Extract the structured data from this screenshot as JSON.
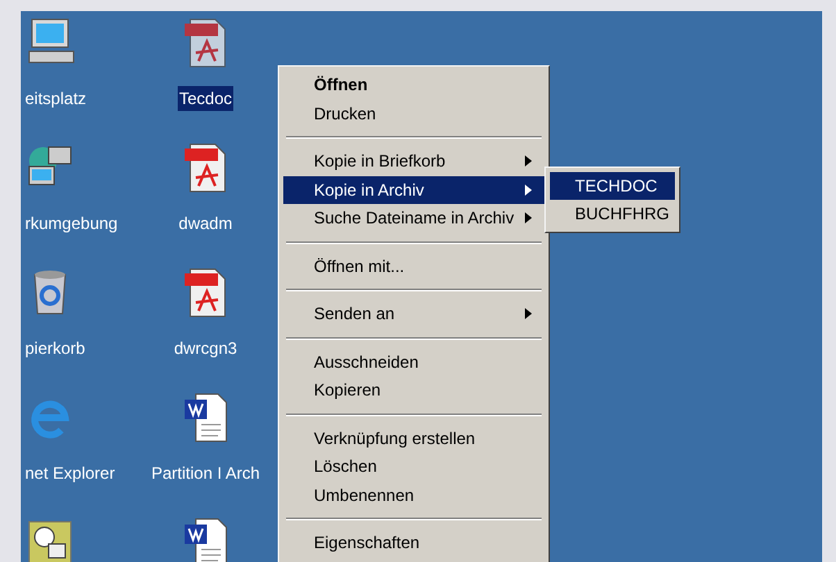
{
  "desktop_icons": [
    {
      "kind": "computer",
      "label": "eitsplatz",
      "selected": false
    },
    {
      "kind": "network",
      "label": "rkumgebung",
      "selected": false
    },
    {
      "kind": "recycle",
      "label": "pierkorb",
      "selected": false
    },
    {
      "kind": "browser",
      "label": "net Explorer",
      "selected": false
    },
    {
      "kind": "task",
      "selected": false
    },
    {
      "kind": "pdf",
      "label": "Tecdoc",
      "selected": true
    },
    {
      "kind": "pdf",
      "label": "dwadm",
      "selected": false
    },
    {
      "kind": "pdf",
      "label": "dwrcgn3",
      "selected": false
    },
    {
      "kind": "word",
      "label": "Partition I Arch",
      "selected": false
    },
    {
      "kind": "word",
      "selected": false
    }
  ],
  "context_menu": {
    "sections": [
      [
        {
          "label": "Öffnen",
          "default": true,
          "submenu": false,
          "selected": false
        },
        {
          "label": "Drucken",
          "default": false,
          "submenu": false,
          "selected": false
        }
      ],
      [
        {
          "label": "Kopie in Briefkorb",
          "default": false,
          "submenu": true,
          "selected": false
        },
        {
          "label": "Kopie in Archiv",
          "default": false,
          "submenu": true,
          "selected": true
        },
        {
          "label": "Suche Dateiname in Archiv",
          "default": false,
          "submenu": true,
          "selected": false
        }
      ],
      [
        {
          "label": "Öffnen mit...",
          "default": false,
          "submenu": false,
          "selected": false
        }
      ],
      [
        {
          "label": "Senden an",
          "default": false,
          "submenu": true,
          "selected": false
        }
      ],
      [
        {
          "label": "Ausschneiden",
          "default": false,
          "submenu": false,
          "selected": false
        },
        {
          "label": "Kopieren",
          "default": false,
          "submenu": false,
          "selected": false
        }
      ],
      [
        {
          "label": "Verknüpfung erstellen",
          "default": false,
          "submenu": false,
          "selected": false
        },
        {
          "label": "Löschen",
          "default": false,
          "submenu": false,
          "selected": false
        },
        {
          "label": "Umbenennen",
          "default": false,
          "submenu": false,
          "selected": false
        }
      ],
      [
        {
          "label": "Eigenschaften",
          "default": false,
          "submenu": false,
          "selected": false
        }
      ]
    ]
  },
  "submenu": {
    "items": [
      {
        "label": "TECHDOC",
        "selected": true
      },
      {
        "label": "BUCHFHRG",
        "selected": false
      }
    ]
  }
}
